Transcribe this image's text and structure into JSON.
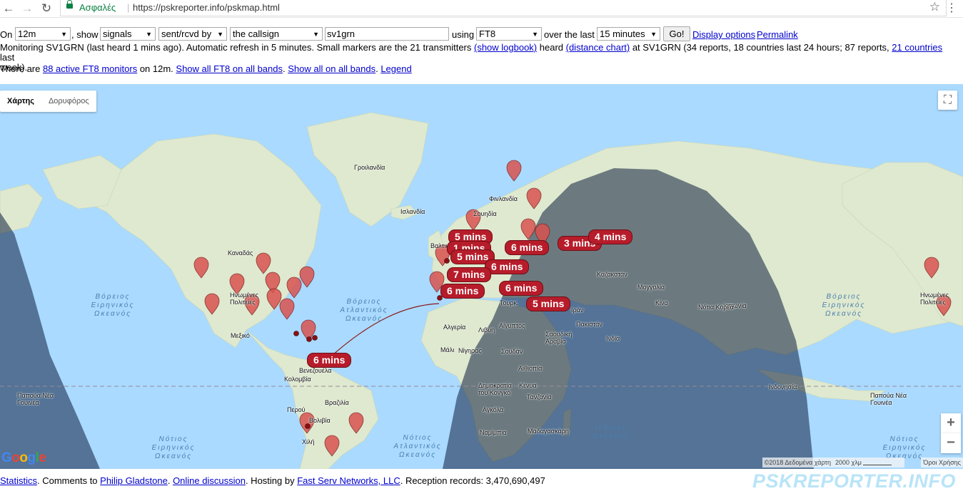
{
  "browser": {
    "secure_label": "Ασφαλές",
    "url": "https://pskreporter.info/pskmap.html",
    "back_icon": "arrow-left-icon",
    "forward_icon": "arrow-right-icon",
    "reload_icon": "reload-icon",
    "bookmark_icon": "star-icon"
  },
  "controls": {
    "on_label": "On",
    "band": "12m",
    "show_label": ", show",
    "show_what": "signals",
    "direction": "sent/rcvd by",
    "target": "the callsign",
    "callsign": "sv1grn",
    "using_label": "using",
    "mode": "FT8",
    "over_label": "over the last",
    "period": "15 minutes",
    "go_label": "Go!",
    "display_options": "Display options",
    "permalink": "Permalink"
  },
  "info": {
    "line1_a": "Monitoring SV1GRN (last heard 1 mins ago). Automatic refresh in 5 minutes. Small markers are the 21 transmitters ",
    "show_logbook": "(show logbook)",
    "line1_b": " heard ",
    "distance_chart": "(distance chart)",
    "line1_c": " at SV1GRN (34 reports, 18 countries last 24 hours; 87 reports, ",
    "countries_link": "21 countries",
    "line1_d": " last",
    "line1_e": "week).",
    "line2_a": "There are ",
    "monitors_link": "88 active FT8 monitors",
    "line2_b": " on 12m. ",
    "show_all_ft8": "Show all FT8 on all bands",
    "show_all": "Show all on all bands",
    "legend": "Legend"
  },
  "map": {
    "type_map": "Χάρτης",
    "type_satellite": "Δορυφόρος",
    "fullscreen_icon": "fullscreen-icon",
    "zoom_in": "+",
    "zoom_out": "−",
    "google_logo": "Google",
    "attribution": "©2018 Δεδομένα χάρτη",
    "scale": "2000 χλμ",
    "terms": "Όροι Χρήσης",
    "places": {
      "greenland": "Γροιλανδία",
      "iceland": "Ισλανδία",
      "finland": "Φινλανδία",
      "sweden": "Σουηδία",
      "canada": "Καναδάς",
      "usa": "Ηνωμένες Πολιτείες",
      "mexico": "Μεξικό",
      "venezuela": "Βενεζουέλα",
      "colombia": "Κολομβία",
      "peru": "Περού",
      "brazil": "Βραζιλία",
      "bolivia": "Βολιβία",
      "chile": "Χιλή",
      "algeria": "Αλγερία",
      "libya": "Λιβύη",
      "egypt": "Αίγυπτος",
      "mali": "Μάλι",
      "niger": "Νίγηρας",
      "sudan": "Σουδάν",
      "ethiopia": "Αιθιοπία",
      "kenya": "Κένυα",
      "tanzania": "Τανζανία",
      "drc": "Δημοκρατία του Κονγκό",
      "angola": "Αγκόλα",
      "namibia": "Ναμίμπια",
      "madagascar": "Μαδαγασκάρη",
      "kazakhstan": "Καζακστάν",
      "china": "Κίνα",
      "mongolia": "Μογγολία",
      "india": "Ινδία",
      "iran": "Ιράν",
      "pakistan": "Πακιστάν",
      "saudi": "Σαουδική Αραβία",
      "turkey": "Τουρκ.",
      "indonesia": "Ινδονησία",
      "png": "Παπούα Νέα Γουινέα",
      "png_right": "Παπούα Νέα Γουινέα",
      "japan": "Ιαπωνία",
      "korea": "Νότια Κορέα",
      "usa_right": "Ηνωμένες Πολιτείες",
      "baltic": "Βαλτική"
    },
    "oceans": {
      "n_pacific_left": "Βόρειος Ειρηνικός Ωκεανός",
      "n_atlantic": "Βόρειος Ατλαντικός Ωκεανός",
      "s_pacific_left": "Νότιος Ειρηνικός Ωκεανός",
      "s_atlantic": "Νότιος Ατλαντικός Ωκεανός",
      "indian": "Ινδικός Ωκεανός",
      "n_pacific_right": "Βόρειος Ειρηνικός Ωκεανός",
      "s_pacific_right": "Νότιος Ειρηνικός Ωκεανός"
    },
    "bubbles": [
      "5 mins",
      "1 mins",
      "5 mins",
      "6 mins",
      "3 mins",
      "4 mins",
      "6 mins",
      "7 mins",
      "6 mins",
      "6 mins",
      "5 mins",
      "6 mins"
    ]
  },
  "footer": {
    "statistics": "Statistics",
    "comments": ". Comments to ",
    "author": "Philip Gladstone",
    "sep1": ". ",
    "discussion": "Online discussion",
    "hosting": ". Hosting by ",
    "host": "Fast Serv Networks, LLC",
    "records": ". Reception records: 3,470,690,497",
    "brand": "PSKREPORTER.INFO"
  }
}
